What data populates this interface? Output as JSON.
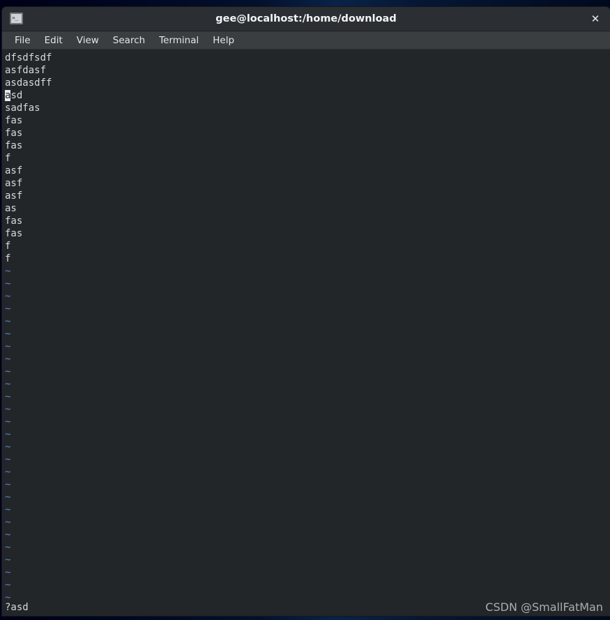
{
  "colors": {
    "desktop_backdrop": "#00091e",
    "titlebar_bg": "#2b2f33",
    "menubar_bg": "#3a3e41",
    "terminal_bg": "#232629",
    "terminal_fg": "#d6dadd",
    "tilde_blue": "#5f7fc4",
    "cursor_bg": "#e8ebed",
    "watermark_fg": "#a9adb1"
  },
  "window": {
    "title": "gee@localhost:/home/download",
    "icon_name": "terminal-icon",
    "icon_glyph": "»_",
    "close_label": "✕"
  },
  "menu": {
    "items": [
      {
        "label": "File"
      },
      {
        "label": "Edit"
      },
      {
        "label": "View"
      },
      {
        "label": "Search"
      },
      {
        "label": "Terminal"
      },
      {
        "label": "Help"
      }
    ]
  },
  "editor": {
    "lines": [
      {
        "text": "dfsdfsdf",
        "cursor": false
      },
      {
        "text": "asfdasf",
        "cursor": false
      },
      {
        "text": "asdasdff",
        "cursor": false
      },
      {
        "text": "asd",
        "cursor": true
      },
      {
        "text": "sadfas",
        "cursor": false
      },
      {
        "text": "fas",
        "cursor": false
      },
      {
        "text": "fas",
        "cursor": false
      },
      {
        "text": "fas",
        "cursor": false
      },
      {
        "text": "f",
        "cursor": false
      },
      {
        "text": "asf",
        "cursor": false
      },
      {
        "text": "asf",
        "cursor": false
      },
      {
        "text": "asf",
        "cursor": false
      },
      {
        "text": "as",
        "cursor": false
      },
      {
        "text": "fas",
        "cursor": false
      },
      {
        "text": "fas",
        "cursor": false
      },
      {
        "text": "f",
        "cursor": false
      },
      {
        "text": "f",
        "cursor": false
      }
    ],
    "empty_marker": "~",
    "empty_marker_count": 27,
    "cursor_char_index": 0
  },
  "status": {
    "command": "?asd",
    "watermark": "CSDN @SmallFatMan"
  }
}
